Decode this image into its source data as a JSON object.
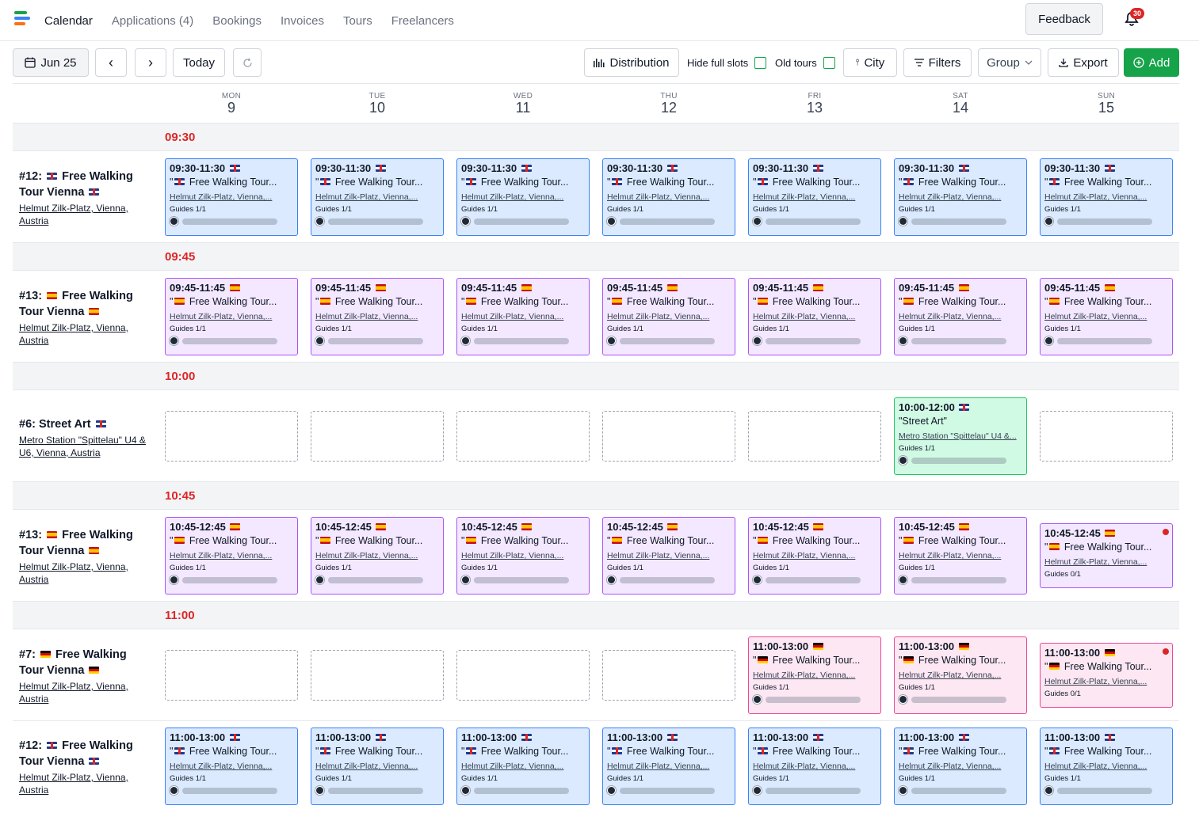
{
  "nav": {
    "items": [
      "Calendar",
      "Applications (4)",
      "Bookings",
      "Invoices",
      "Tours",
      "Freelancers"
    ],
    "active": 0,
    "feedback": "Feedback",
    "notifications": "30"
  },
  "toolbar": {
    "date": "Jun 25",
    "prev": "‹",
    "next": "›",
    "today": "Today",
    "distribution": "Distribution",
    "hide_full_slots": "Hide full slots",
    "old_tours": "Old tours",
    "city": "City",
    "filters": "Filters",
    "group": "Group",
    "export": "Export",
    "add": "Add"
  },
  "days": [
    {
      "name": "MON",
      "num": "9"
    },
    {
      "name": "TUE",
      "num": "10"
    },
    {
      "name": "WED",
      "num": "11"
    },
    {
      "name": "THU",
      "num": "12"
    },
    {
      "name": "FRI",
      "num": "13"
    },
    {
      "name": "SAT",
      "num": "14"
    },
    {
      "name": "SUN",
      "num": "15"
    }
  ],
  "timebands": [
    "09:30",
    "09:45",
    "10:00",
    "10:45",
    "11:00"
  ],
  "rows": [
    {
      "title": "#12: 🇬🇧 Free Walking Tour Vienna 🇬🇧",
      "title_pre": "#12:",
      "title_main": "Free Walking Tour Vienna",
      "flag": "uk",
      "address": "Helmut Zilk-Platz, Vienna, Austria",
      "card_time": "09:30-11:30",
      "card_name": "\"🇬🇧 Free Walking Tour...",
      "card_loc": "Helmut Zilk-Platz, Vienna,...",
      "card_guides": "Guides 1/1",
      "color": "blue"
    },
    {
      "title_pre": "#13:",
      "title_main": "Free Walking Tour Vienna",
      "flag": "es",
      "address": "Helmut Zilk-Platz, Vienna, Austria",
      "card_time": "09:45-11:45",
      "card_name": "Free Walking Tour...",
      "card_loc": "Helmut Zilk-Platz, Vienna,...",
      "card_guides": "Guides 1/1",
      "color": "purple"
    },
    {
      "title_pre": "#6:",
      "title_main": "Street Art",
      "flag": "uk",
      "address": "Metro Station \"Spittelau\" U4 & U6, Vienna, Austria",
      "card_time": "10:00-12:00",
      "card_name": "\"Street Art\"",
      "card_loc": "Metro Station \"Spittelau\" U4 &...",
      "card_guides": "Guides 1/1",
      "color": "green"
    },
    {
      "title_pre": "#13:",
      "title_main": "Free Walking Tour Vienna",
      "flag": "es",
      "address": "Helmut Zilk-Platz, Vienna, Austria",
      "card_time": "10:45-12:45",
      "card_name": "Free Walking Tour...",
      "card_loc": "Helmut Zilk-Platz, Vienna,...",
      "card_guides": "Guides 1/1",
      "card_guides_sun": "Guides 0/1",
      "color": "purple"
    },
    {
      "title_pre": "#7:",
      "title_main": "Free Walking Tour Vienna",
      "flag": "de",
      "address": "Helmut Zilk-Platz, Vienna, Austria",
      "card_time": "11:00-13:00",
      "card_name": "Free Walking Tour...",
      "card_loc": "Helmut Zilk-Platz, Vienna,...",
      "card_guides": "Guides 1/1",
      "card_guides_sun": "Guides 0/1",
      "color": "pink"
    },
    {
      "title_pre": "#12:",
      "title_main": "Free Walking Tour Vienna",
      "flag": "uk",
      "address": "Helmut Zilk-Platz, Vienna, Austria",
      "card_time": "11:00-13:00",
      "card_name": "Free Walking Tour...",
      "card_loc": "Helmut Zilk-Platz, Vienna,...",
      "card_guides": "Guides 1/1",
      "color": "blue"
    }
  ],
  "colors": {
    "accent": "#16a34a",
    "time": "#dc2626",
    "blue": "#dbeafe",
    "purple": "#f3e8ff",
    "green": "#d1fae5",
    "pink": "#fce7f3"
  }
}
